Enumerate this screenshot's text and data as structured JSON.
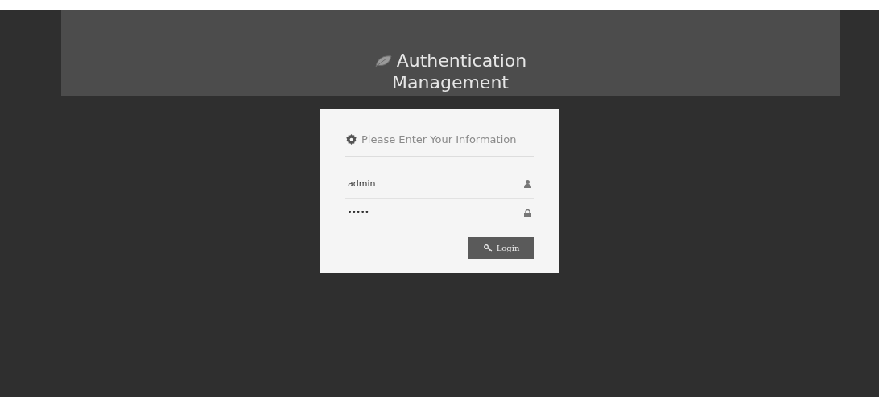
{
  "header": {
    "title_line_1": "Authentication",
    "title_line_2": "Management"
  },
  "login_form": {
    "title": "Please Enter Your Information",
    "username": {
      "value": "admin"
    },
    "password": {
      "value": "•••••"
    },
    "submit_button": "Login"
  }
}
